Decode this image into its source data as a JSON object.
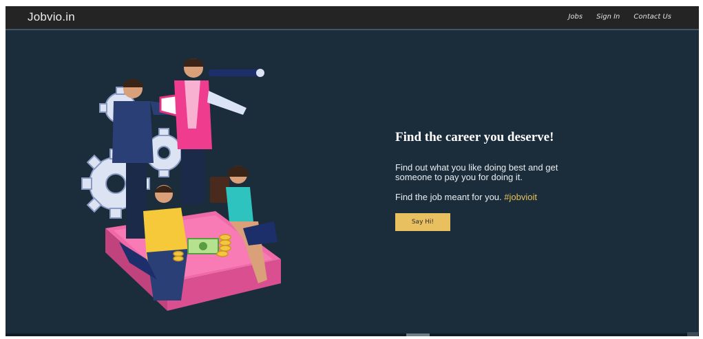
{
  "brand": "Jobvio.in",
  "nav": {
    "jobs": "Jobs",
    "signin": "Sign In",
    "contact": "Contact Us"
  },
  "hero": {
    "title": "Find the career you deserve!",
    "description": "Find out what you like doing best and get someone to pay you for doing it.",
    "tagline": "Find the job meant for you.",
    "hashtag": "#jobvioit",
    "cta": "Say Hi!"
  },
  "colors": {
    "navbar": "#242424",
    "background": "#1b2d3b",
    "accent": "#e8c060",
    "hashtag": "#e8c25d"
  }
}
